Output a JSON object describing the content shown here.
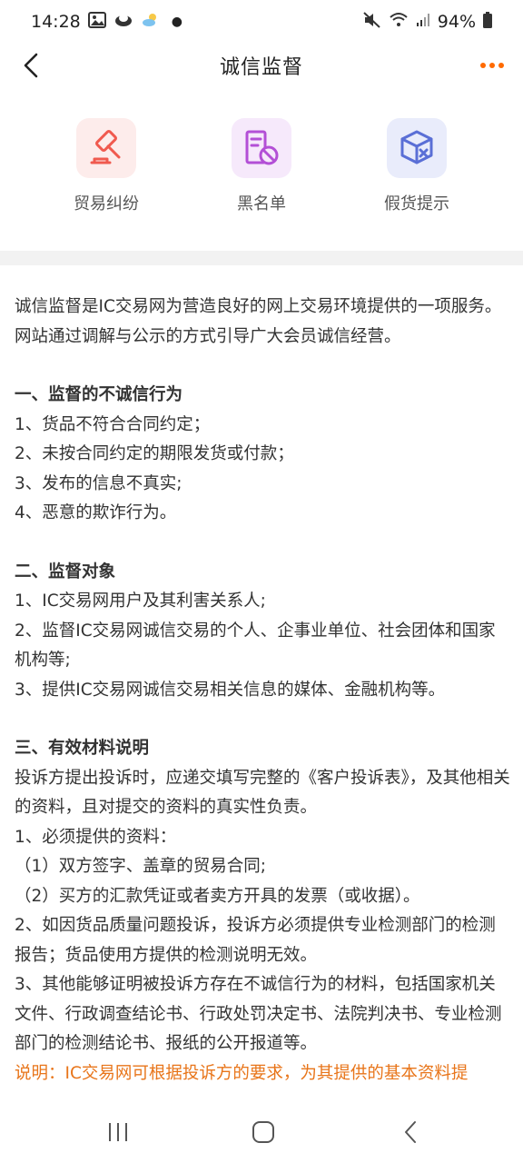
{
  "status_bar": {
    "time": "14:28",
    "battery": "94%"
  },
  "header": {
    "title": "诚信监督"
  },
  "features": [
    {
      "label": "贸易纠纷",
      "icon": "gavel-icon",
      "color": "#f05a4f",
      "bg": "#fdeceb"
    },
    {
      "label": "黑名单",
      "icon": "blacklist-icon",
      "color": "#b34fd6",
      "bg": "#f6e9fb"
    },
    {
      "label": "假货提示",
      "icon": "fake-box-icon",
      "color": "#5a6fd6",
      "bg": "#e9ecfb"
    }
  ],
  "content": {
    "intro": "诚信监督是IC交易网为营造良好的网上交易环境提供的一项服务。网站通过调解与公示的方式引导广大会员诚信经营。",
    "section1": {
      "title": "一、监督的不诚信行为",
      "items": [
        "1、货品不符合合同约定；",
        "2、未按合同约定的期限发货或付款；",
        "3、发布的信息不真实;",
        "4、恶意的欺诈行为。"
      ]
    },
    "section2": {
      "title": "二、监督对象",
      "items": [
        "1、IC交易网用户及其利害关系人;",
        "2、监督IC交易网诚信交易的个人、企事业单位、社会团体和国家机构等;",
        "3、提供IC交易网诚信交易相关信息的媒体、金融机构等。"
      ]
    },
    "section3": {
      "title": "三、有效材料说明",
      "items": [
        "投诉方提出投诉时，应递交填写完整的《客户投诉表》，及其他相关的资料，且对提交的资料的真实性负责。",
        "1、必须提供的资料：",
        "（1）双方签字、盖章的贸易合同;",
        "（2）买方的汇款凭证或者卖方开具的发票（或收据）。",
        "2、如因货品质量问题投诉，投诉方必须提供专业检测部门的检测报告；货品使用方提供的检测说明无效。",
        "3、其他能够证明被投诉方存在不诚信行为的材料，包括国家机关文件、行政调查结论书、行政处罚决定书、法院判决书、专业检测部门的检测结论书、报纸的公开报道等。"
      ]
    },
    "note": "说明：IC交易网可根据投诉方的要求，为其提供的基本资料提"
  },
  "colors": {
    "accent": "#ff6a00",
    "note": "#e8751a"
  }
}
